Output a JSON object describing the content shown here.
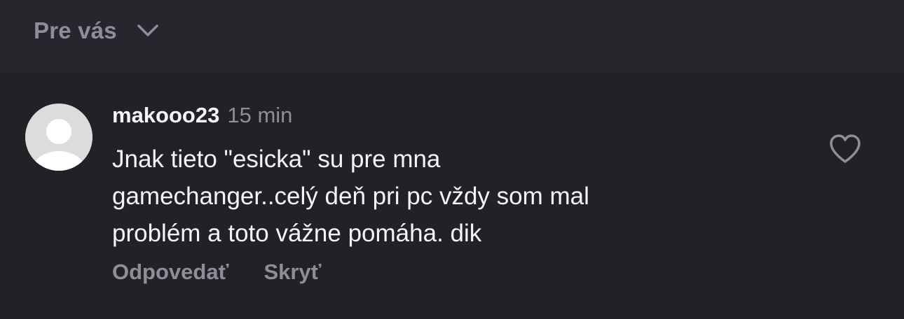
{
  "header": {
    "sort_label": "Pre vás",
    "sort_icon": "chevron-down-icon"
  },
  "comment": {
    "avatar_icon": "default-avatar-icon",
    "username": "makooo23",
    "timestamp": "15 min",
    "text_lines": [
      "Jnak tieto \"esicka\" su pre mna",
      "gamechanger..celý deň pri pc vždy som mal",
      "problém a toto vážne pomáha. dik"
    ],
    "like_icon": "heart-outline-icon",
    "actions": {
      "reply_label": "Odpovedať",
      "hide_label": "Skryť"
    }
  },
  "colors": {
    "background": "#212126",
    "top_bar": "#26272c",
    "primary_text": "#f5f5f7",
    "secondary_text": "#8e8f96",
    "avatar_bg": "#dcdcdc"
  }
}
